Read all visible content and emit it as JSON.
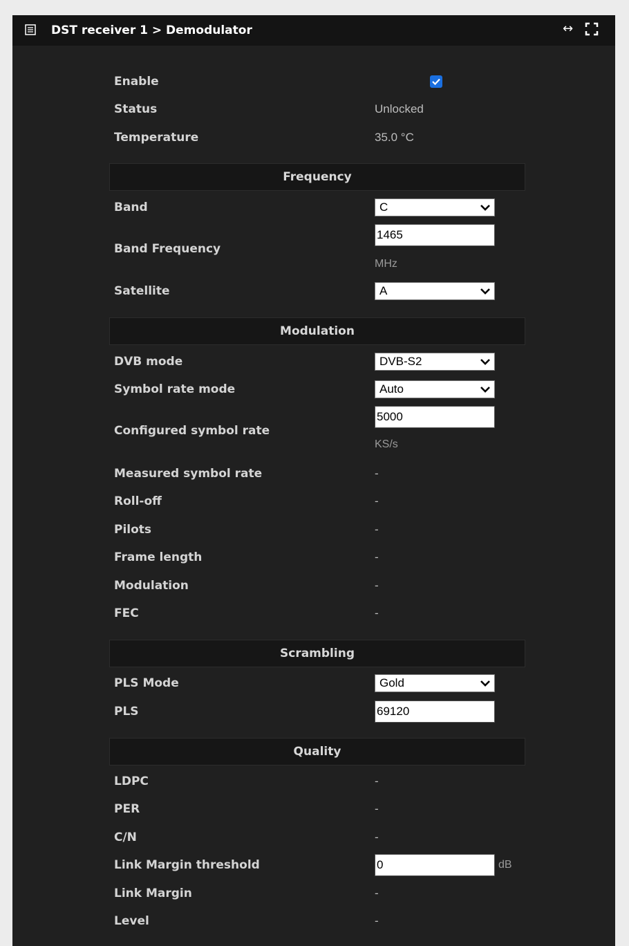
{
  "header": {
    "title": "DST receiver 1 > Demodulator",
    "resize_icon": "↔"
  },
  "general": {
    "enable_label": "Enable",
    "enable_checked": true,
    "status_label": "Status",
    "status_value": "Unlocked",
    "temperature_label": "Temperature",
    "temperature_value": "35.0 °C"
  },
  "frequency": {
    "section_title": "Frequency",
    "band_label": "Band",
    "band_value": "C",
    "band_frequency_label": "Band Frequency",
    "band_frequency_value": "1465",
    "band_frequency_unit": "MHz",
    "satellite_label": "Satellite",
    "satellite_value": "A"
  },
  "modulation": {
    "section_title": "Modulation",
    "dvb_mode_label": "DVB mode",
    "dvb_mode_value": "DVB-S2",
    "symbol_rate_mode_label": "Symbol rate mode",
    "symbol_rate_mode_value": "Auto",
    "configured_symbol_rate_label": "Configured symbol rate",
    "configured_symbol_rate_value": "5000",
    "configured_symbol_rate_unit": "KS/s",
    "measured_symbol_rate_label": "Measured symbol rate",
    "measured_symbol_rate_value": "-",
    "roll_off_label": "Roll-off",
    "roll_off_value": "-",
    "pilots_label": "Pilots",
    "pilots_value": "-",
    "frame_length_label": "Frame length",
    "frame_length_value": "-",
    "modulation_label": "Modulation",
    "modulation_value": "-",
    "fec_label": "FEC",
    "fec_value": "-"
  },
  "scrambling": {
    "section_title": "Scrambling",
    "pls_mode_label": "PLS Mode",
    "pls_mode_value": "Gold",
    "pls_label": "PLS",
    "pls_value": "69120"
  },
  "quality": {
    "section_title": "Quality",
    "ldpc_label": "LDPC",
    "ldpc_value": "-",
    "per_label": "PER",
    "per_value": "-",
    "cn_label": "C/N",
    "cn_value": "-",
    "link_margin_threshold_label": "Link Margin threshold",
    "link_margin_threshold_value": "0",
    "link_margin_threshold_unit": "dB",
    "link_margin_label": "Link Margin",
    "link_margin_value": "-",
    "level_label": "Level",
    "level_value": "-"
  },
  "colors": {
    "panel_bg": "#202020",
    "header_bg": "#141414",
    "section_bg": "#161616",
    "checkbox_accent": "#1a6fe0"
  },
  "icons": {
    "header_icon": "list-icon",
    "resize": "horizontal-resize-icon",
    "maximize": "maximize-icon",
    "dropdown": "chevron-down-icon",
    "checkbox": "check-icon"
  }
}
